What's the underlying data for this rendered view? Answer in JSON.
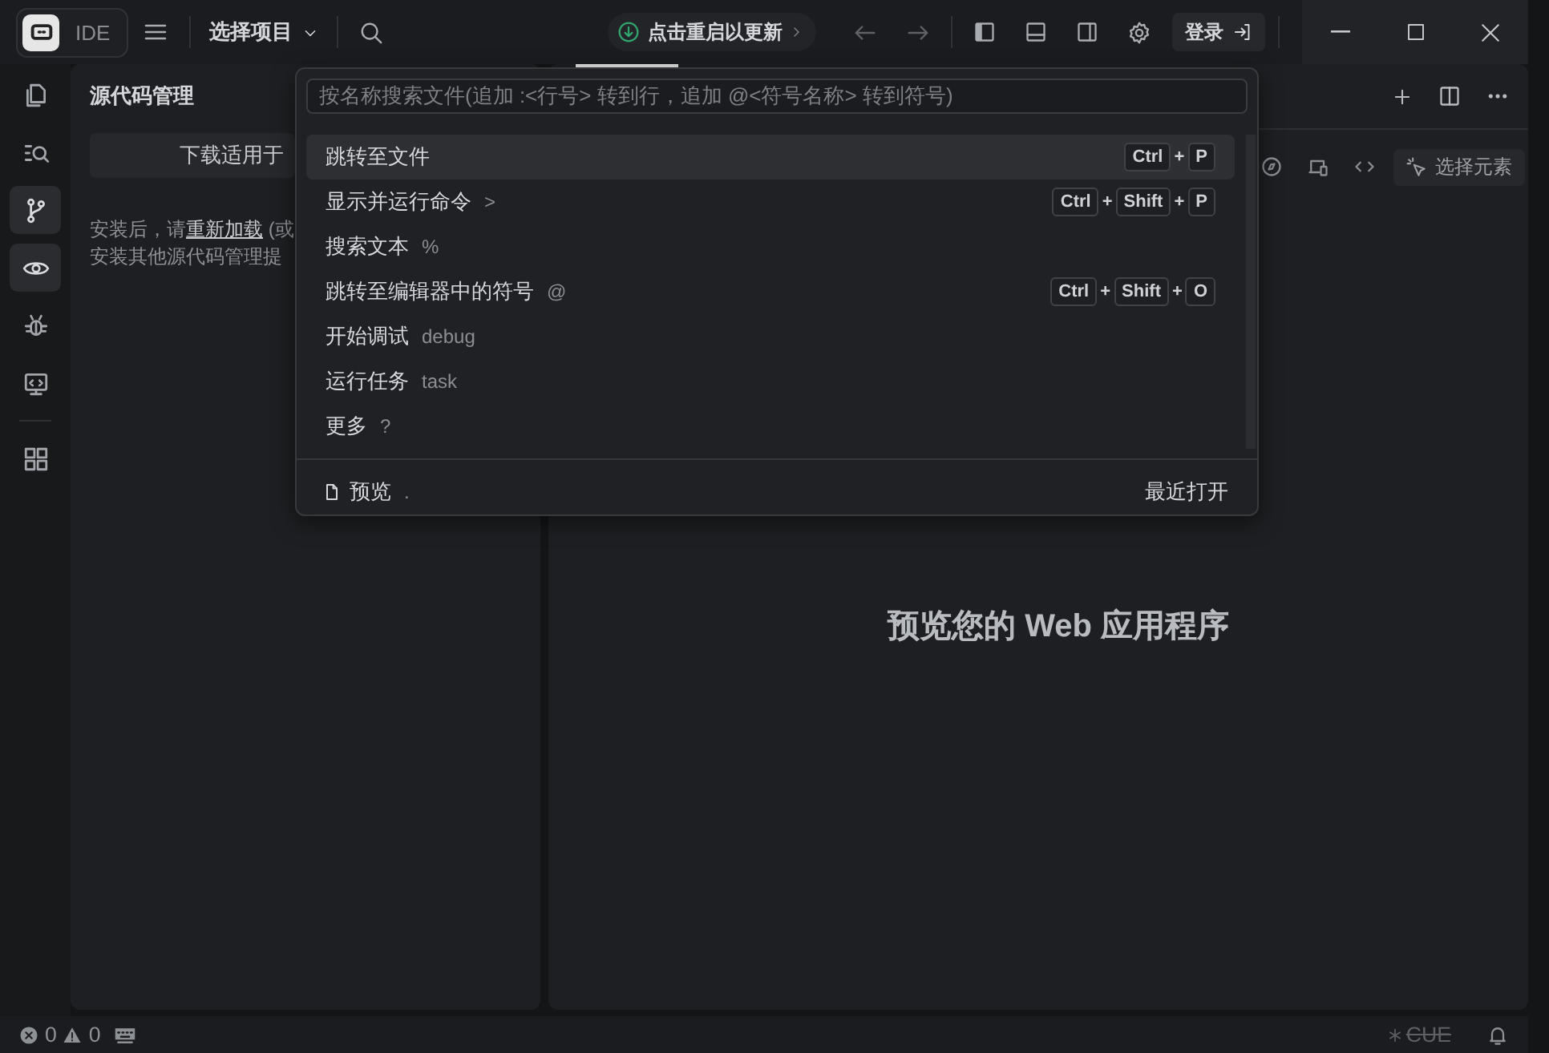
{
  "titlebar": {
    "logo_text": "IDE",
    "project": "选择项目",
    "update": "点击重启以更新",
    "login": "登录"
  },
  "activity_bar": {
    "items": [
      {
        "kind": "files",
        "selected": false
      },
      {
        "kind": "search",
        "selected": false
      },
      {
        "kind": "source-control",
        "selected": true
      },
      {
        "kind": "preview",
        "selected": true
      },
      {
        "kind": "debug",
        "selected": false
      },
      {
        "kind": "remote",
        "selected": false
      },
      {
        "kind": "extensions",
        "selected": false
      }
    ]
  },
  "source_control": {
    "title": "源代码管理",
    "download_button": "下载适用于",
    "text_before_link": "安装后，请",
    "link": "重新加载",
    "text_after_link": "(或",
    "second_line": "安装其他源代码管理提"
  },
  "editor": {
    "select_element": "选择元素",
    "placeholder_title": "预览您的 Web 应用程序"
  },
  "command_palette": {
    "placeholder": "按名称搜索文件(追加 :<行号> 转到行，追加 @<符号名称> 转到符号)",
    "items": [
      {
        "label": "跳转至文件",
        "keys": [
          "Ctrl",
          "+",
          "P"
        ],
        "selected": true
      },
      {
        "label": "显示并运行命令",
        "hint": ">",
        "keys": [
          "Ctrl",
          "+",
          "Shift",
          "+",
          "P"
        ],
        "selected": false
      },
      {
        "label": "搜索文本",
        "hint": "%",
        "selected": false
      },
      {
        "label": "跳转至编辑器中的符号",
        "hint": "@",
        "keys": [
          "Ctrl",
          "+",
          "Shift",
          "+",
          "O"
        ],
        "selected": false
      },
      {
        "label": "开始调试",
        "hint": "debug",
        "selected": false
      },
      {
        "label": "运行任务",
        "hint": "task",
        "selected": false
      },
      {
        "label": "更多",
        "hint": "?",
        "selected": false
      }
    ],
    "footer": {
      "label": "预览",
      "hint": ".",
      "recent": "最近打开"
    }
  },
  "status_bar": {
    "errors": "0",
    "warnings": "0",
    "cue": "CUE"
  }
}
